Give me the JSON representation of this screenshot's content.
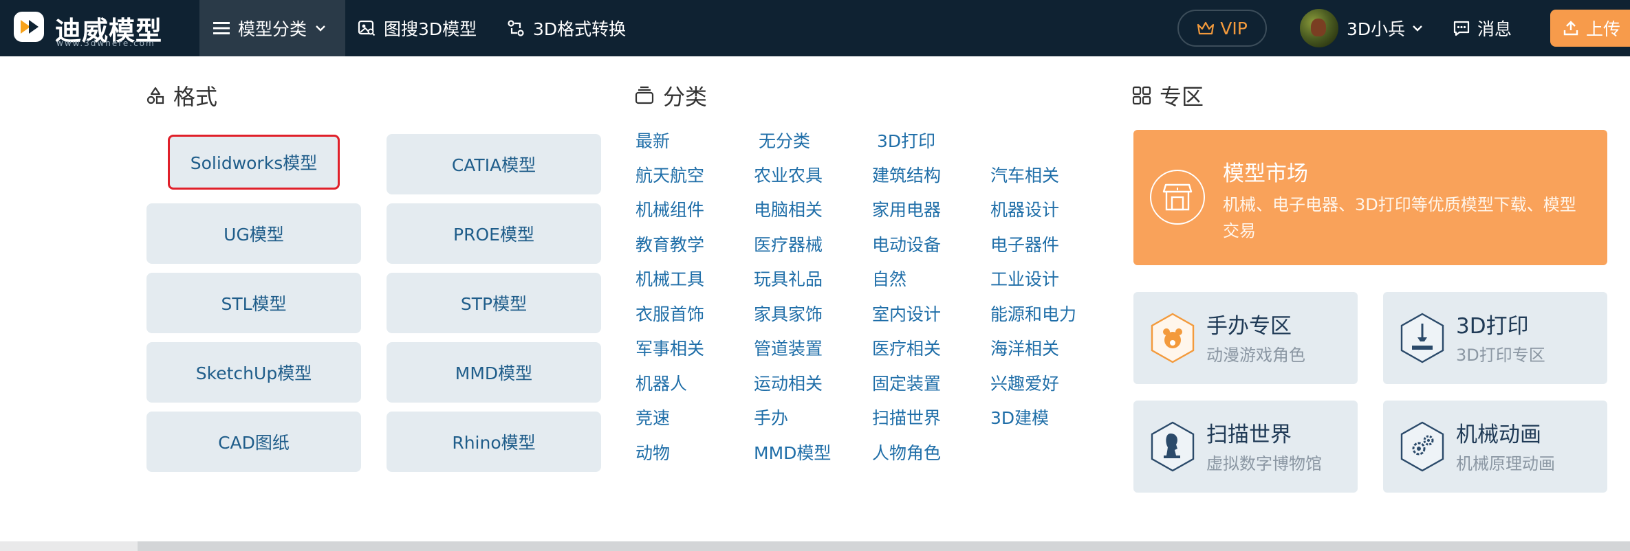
{
  "brand": {
    "title": "迪威模型",
    "subtitle": "www.3dwhere.com"
  },
  "nav": {
    "category_label": "模型分类",
    "image_search_label": "图搜3D模型",
    "format_convert_label": "3D格式转换"
  },
  "header_right": {
    "vip_label": "VIP",
    "user_name": "3D小兵",
    "messages_label": "消息",
    "upload_label": "上传"
  },
  "colors": {
    "topbar": "#0f2232",
    "accent_orange": "#f79b4b",
    "link_blue": "#1f6ea8",
    "selection_red": "#e0202a"
  },
  "format_section": {
    "title": "格式",
    "items": [
      "Solidworks模型",
      "CATIA模型",
      "UG模型",
      "PROE模型",
      "STL模型",
      "STP模型",
      "SketchUp模型",
      "MMD模型",
      "CAD图纸",
      "Rhino模型"
    ]
  },
  "category_section": {
    "title": "分类",
    "items": [
      "最新",
      "无分类",
      "3D打印",
      "航天航空",
      "农业农具",
      "建筑结构",
      "汽车相关",
      "机械组件",
      "电脑相关",
      "家用电器",
      "机器设计",
      "教育教学",
      "医疗器械",
      "电动设备",
      "电子器件",
      "机械工具",
      "玩具礼品",
      "自然",
      "工业设计",
      "衣服首饰",
      "家具家饰",
      "室内设计",
      "能源和电力",
      "军事相关",
      "管道装置",
      "医疗相关",
      "海洋相关",
      "机器人",
      "运动相关",
      "固定装置",
      "兴趣爱好",
      "竞速",
      "手办",
      "扫描世界",
      "3D建模",
      "动物",
      "MMD模型",
      "人物角色"
    ]
  },
  "zone_section": {
    "title": "专区",
    "market": {
      "title": "模型市场",
      "description": "机械、电子电器、3D打印等优质模型下载、模型交易"
    },
    "cards": [
      {
        "title": "手办专区",
        "subtitle": "动漫游戏角色",
        "icon": "bear-hexagon-icon"
      },
      {
        "title": "3D打印",
        "subtitle": "3D打印专区",
        "icon": "printer-hexagon-icon"
      },
      {
        "title": "扫描世界",
        "subtitle": "虚拟数字博物馆",
        "icon": "bust-hexagon-icon"
      },
      {
        "title": "机械动画",
        "subtitle": "机械原理动画",
        "icon": "gear-hexagon-icon"
      }
    ]
  }
}
